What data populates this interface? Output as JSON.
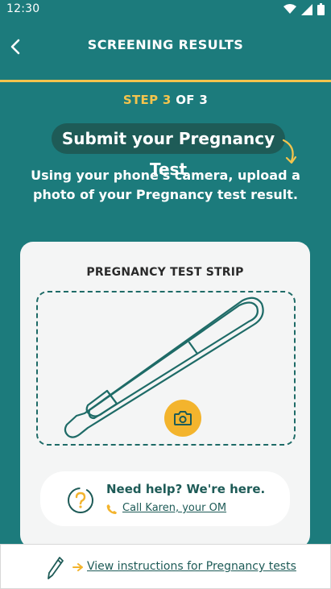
{
  "status_bar": {
    "time": "12:30"
  },
  "app_bar": {
    "title": "SCREENING RESULTS"
  },
  "step": {
    "prefix": "STEP ",
    "current": "3",
    "suffix": " OF 3"
  },
  "heading": "Submit your Pregnancy Test",
  "description": "Using your phone's camera, upload a photo of your Pregnancy test result.",
  "card": {
    "title": "PREGNANCY TEST STRIP"
  },
  "help": {
    "title": "Need help? We're here.",
    "link": "Call Karen, your OM"
  },
  "bottom": {
    "link": "View instructions for Pregnancy tests"
  },
  "colors": {
    "background": "#1c7b7c",
    "accent": "#f3c44d",
    "dark_teal": "#1e5b57"
  }
}
